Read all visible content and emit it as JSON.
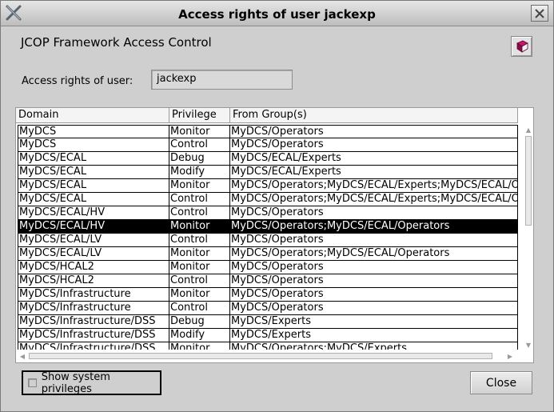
{
  "window": {
    "title": "Access rights of user jackexp"
  },
  "header": {
    "heading": "JCOP Framework Access Control",
    "help_icon": "help-book-icon"
  },
  "user": {
    "label": "Access rights of user:",
    "value": "jackexp"
  },
  "table": {
    "columns": [
      "Domain",
      "Privilege",
      "From Group(s)"
    ],
    "rows": [
      {
        "domain": "MyDCS",
        "privilege": "Monitor",
        "groups": "MyDCS/Operators"
      },
      {
        "domain": "MyDCS",
        "privilege": "Control",
        "groups": "MyDCS/Operators"
      },
      {
        "domain": "MyDCS/ECAL",
        "privilege": "Debug",
        "groups": "MyDCS/ECAL/Experts"
      },
      {
        "domain": "MyDCS/ECAL",
        "privilege": "Modify",
        "groups": "MyDCS/ECAL/Experts"
      },
      {
        "domain": "MyDCS/ECAL",
        "privilege": "Monitor",
        "groups": "MyDCS/Operators;MyDCS/ECAL/Experts;MyDCS/ECAL/O"
      },
      {
        "domain": "MyDCS/ECAL",
        "privilege": "Control",
        "groups": "MyDCS/Operators;MyDCS/ECAL/Experts;MyDCS/ECAL/O"
      },
      {
        "domain": "MyDCS/ECAL/HV",
        "privilege": "Control",
        "groups": "MyDCS/Operators"
      },
      {
        "domain": "MyDCS/ECAL/HV",
        "privilege": "Monitor",
        "groups": "MyDCS/Operators;MyDCS/ECAL/Operators",
        "selected": true
      },
      {
        "domain": "MyDCS/ECAL/LV",
        "privilege": "Control",
        "groups": "MyDCS/Operators"
      },
      {
        "domain": "MyDCS/ECAL/LV",
        "privilege": "Monitor",
        "groups": "MyDCS/Operators;MyDCS/ECAL/Operators"
      },
      {
        "domain": "MyDCS/HCAL2",
        "privilege": "Monitor",
        "groups": "MyDCS/Operators"
      },
      {
        "domain": "MyDCS/HCAL2",
        "privilege": "Control",
        "groups": "MyDCS/Operators"
      },
      {
        "domain": "MyDCS/Infrastructure",
        "privilege": "Monitor",
        "groups": "MyDCS/Operators"
      },
      {
        "domain": "MyDCS/Infrastructure",
        "privilege": "Control",
        "groups": "MyDCS/Operators"
      },
      {
        "domain": "MyDCS/Infrastructure/DSS",
        "privilege": "Debug",
        "groups": "MyDCS/Experts"
      },
      {
        "domain": "MyDCS/Infrastructure/DSS",
        "privilege": "Modify",
        "groups": "MyDCS/Experts"
      },
      {
        "domain": "MyDCS/Infrastructure/DSS",
        "privilege": "Monitor",
        "groups": "MyDCS/Operators;MyDCS/Experts"
      }
    ]
  },
  "footer": {
    "show_system_label": "Show system privileges",
    "show_system_checked": false,
    "close_label": "Close"
  },
  "colors": {
    "selection_bg": "#000000",
    "selection_fg": "#ffffff",
    "window_bg": "#cfcfcf"
  }
}
